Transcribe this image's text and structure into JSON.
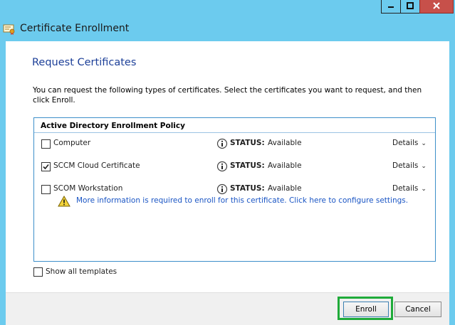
{
  "window": {
    "title": "Certificate Enrollment",
    "controls": {
      "minimize": "minimize-icon",
      "maximize": "maximize-icon",
      "close": "close-icon"
    }
  },
  "page": {
    "heading": "Request Certificates",
    "description": "You can request the following types of certificates. Select the certificates you want to request, and then click Enroll."
  },
  "policy": {
    "title": "Active Directory Enrollment Policy",
    "certificates": [
      {
        "name": "Computer",
        "checked": false,
        "status_label": "STATUS:",
        "status_value": "Available",
        "details_label": "Details"
      },
      {
        "name": "SCCM Cloud Certificate",
        "checked": true,
        "status_label": "STATUS:",
        "status_value": "Available",
        "details_label": "Details"
      },
      {
        "name": "SCOM Workstation",
        "checked": false,
        "status_label": "STATUS:",
        "status_value": "Available",
        "details_label": "Details"
      }
    ],
    "warning_link": "More information is required to enroll for this certificate. Click here to configure settings."
  },
  "show_all": {
    "label": "Show all templates",
    "checked": false
  },
  "buttons": {
    "enroll": "Enroll",
    "cancel": "Cancel"
  },
  "colors": {
    "titlebar": "#6ccbee",
    "heading": "#1c3f98",
    "link": "#1a55c4",
    "highlight": "#1fab3a",
    "close": "#c7504a"
  }
}
